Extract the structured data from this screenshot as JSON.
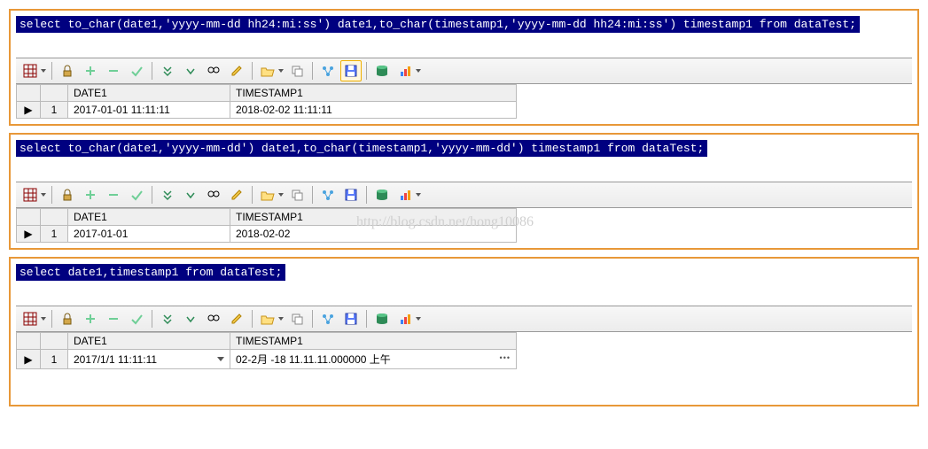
{
  "panels": [
    {
      "sql": "select to_char(date1,'yyyy-mm-dd hh24:mi:ss') date1,to_char(timestamp1,'yyyy-mm-dd hh24:mi:ss') timestamp1 from dataTest;",
      "cols": {
        "c1": "DATE1",
        "c2": "TIMESTAMP1"
      },
      "row": {
        "n": "1",
        "date1": "2017-01-01 11:11:11",
        "ts1": "2018-02-02 11:11:11"
      },
      "has_dropdown": false,
      "save_highlight": true
    },
    {
      "sql": "select to_char(date1,'yyyy-mm-dd') date1,to_char(timestamp1,'yyyy-mm-dd') timestamp1 from dataTest;",
      "cols": {
        "c1": "DATE1",
        "c2": "TIMESTAMP1"
      },
      "row": {
        "n": "1",
        "date1": "2017-01-01",
        "ts1": "2018-02-02"
      },
      "has_dropdown": false,
      "save_highlight": false
    },
    {
      "sql": "select date1,timestamp1 from dataTest;",
      "cols": {
        "c1": "DATE1",
        "c2": "TIMESTAMP1"
      },
      "row": {
        "n": "1",
        "date1": "2017/1/1 11:11:11",
        "ts1": "02-2月 -18 11.11.11.000000 上午"
      },
      "has_dropdown": true,
      "save_highlight": false
    }
  ],
  "watermark": "http://blog.csdn.net/hong10086",
  "icons": {
    "grid": "grid-icon",
    "lock": "lock-icon",
    "plus": "plus-icon",
    "minus": "minus-icon",
    "check": "check-icon",
    "dnall": "fetch-all-icon",
    "dn": "fetch-page-icon",
    "binoc": "find-icon",
    "pencil": "edit-icon",
    "folder": "open-icon",
    "copy": "copy-icon",
    "link": "link-icon",
    "save": "save-icon",
    "db": "db-icon",
    "chart": "chart-icon"
  }
}
